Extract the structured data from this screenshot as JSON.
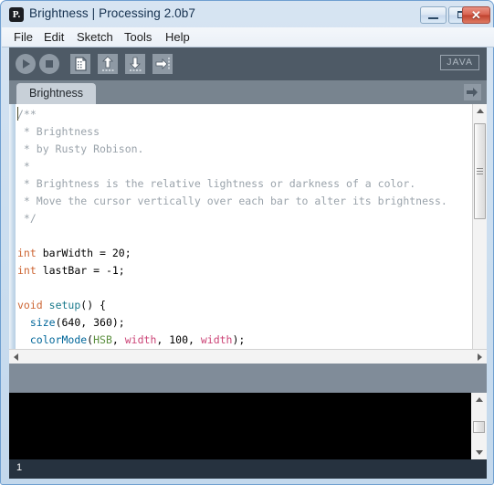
{
  "window": {
    "title": "Brightness | Processing 2.0b7",
    "app_icon": "processing-logo-icon",
    "icon_glyph": "P.",
    "controls": {
      "minimize": "minimize-icon",
      "maximize": "maximize-icon",
      "close_glyph": "✕"
    }
  },
  "menubar": {
    "items": [
      {
        "label": "File"
      },
      {
        "label": "Edit"
      },
      {
        "label": "Sketch"
      },
      {
        "label": "Tools"
      },
      {
        "label": "Help"
      }
    ]
  },
  "toolbar": {
    "buttons": [
      {
        "name": "run-button",
        "icon": "play-icon",
        "label": "Run"
      },
      {
        "name": "stop-button",
        "icon": "stop-icon",
        "label": "Stop"
      },
      {
        "name": "new-button",
        "icon": "new-file-icon",
        "label": "New"
      },
      {
        "name": "open-button",
        "icon": "open-up-arrow-icon",
        "label": "Open"
      },
      {
        "name": "save-button",
        "icon": "save-down-arrow-icon",
        "label": "Save"
      },
      {
        "name": "export-button",
        "icon": "export-right-arrow-icon",
        "label": "Export"
      }
    ],
    "mode_badge": "JAVA"
  },
  "tabbar": {
    "tabs": [
      {
        "label": "Brightness",
        "active": true
      }
    ],
    "next_tab_icon": "arrow-right-icon"
  },
  "editor": {
    "lines": [
      {
        "tokens": [
          {
            "t": "/**",
            "c": "cmt"
          }
        ]
      },
      {
        "tokens": [
          {
            "t": " * Brightness",
            "c": "cmt"
          }
        ]
      },
      {
        "tokens": [
          {
            "t": " * by Rusty Robison.",
            "c": "cmt"
          }
        ]
      },
      {
        "tokens": [
          {
            "t": " * ",
            "c": "cmt"
          }
        ]
      },
      {
        "tokens": [
          {
            "t": " * Brightness is the relative lightness or darkness of a color.",
            "c": "cmt"
          }
        ]
      },
      {
        "tokens": [
          {
            "t": " * Move the cursor vertically over each bar to alter its brightness.",
            "c": "cmt"
          }
        ]
      },
      {
        "tokens": [
          {
            "t": " */",
            "c": "cmt"
          }
        ]
      },
      {
        "tokens": [
          {
            "t": "",
            "c": "pln"
          }
        ]
      },
      {
        "tokens": [
          {
            "t": "int",
            "c": "kw"
          },
          {
            "t": " barWidth = 20;",
            "c": "pln"
          }
        ]
      },
      {
        "tokens": [
          {
            "t": "int",
            "c": "kw"
          },
          {
            "t": " lastBar = -1;",
            "c": "pln"
          }
        ]
      },
      {
        "tokens": [
          {
            "t": "",
            "c": "pln"
          }
        ]
      },
      {
        "tokens": [
          {
            "t": "void",
            "c": "kw"
          },
          {
            "t": " ",
            "c": "pln"
          },
          {
            "t": "setup",
            "c": "fn2"
          },
          {
            "t": "() {",
            "c": "pln"
          }
        ]
      },
      {
        "tokens": [
          {
            "t": "  ",
            "c": "pln"
          },
          {
            "t": "size",
            "c": "fn"
          },
          {
            "t": "(640, 360);",
            "c": "pln"
          }
        ]
      },
      {
        "tokens": [
          {
            "t": "  ",
            "c": "pln"
          },
          {
            "t": "colorMode",
            "c": "fn"
          },
          {
            "t": "(",
            "c": "pln"
          },
          {
            "t": "HSB",
            "c": "cst"
          },
          {
            "t": ", ",
            "c": "pln"
          },
          {
            "t": "width",
            "c": "var"
          },
          {
            "t": ", 100, ",
            "c": "pln"
          },
          {
            "t": "width",
            "c": "var"
          },
          {
            "t": ");",
            "c": "pln"
          }
        ]
      }
    ],
    "scrollbars": {
      "vertical": {
        "name": "editor-vertical-scrollbar",
        "up": "arrow-up-icon",
        "down": "arrow-down-icon"
      },
      "horizontal": {
        "name": "editor-horizontal-scrollbar",
        "left": "arrow-left-icon",
        "right": "arrow-right-icon"
      }
    }
  },
  "console": {
    "text": "",
    "scrollbar": {
      "up": "arrow-up-icon",
      "down": "arrow-down-icon"
    }
  },
  "statusbar": {
    "line_number": "1"
  },
  "colors": {
    "titlebar_text": "#14304e",
    "toolbar_bg": "#4e5a66",
    "tabbar_bg": "#78848f",
    "tab_active_bg": "#c8d0d8",
    "message_bar_bg": "#808c99",
    "console_bg": "#000000",
    "statusbar_bg": "#26323f",
    "comment": "#9aa3ab",
    "keyword": "#cd6634",
    "function": "#006699",
    "constant": "#5b8f3e",
    "variable": "#cc4477",
    "close_button": "#c0412e"
  }
}
